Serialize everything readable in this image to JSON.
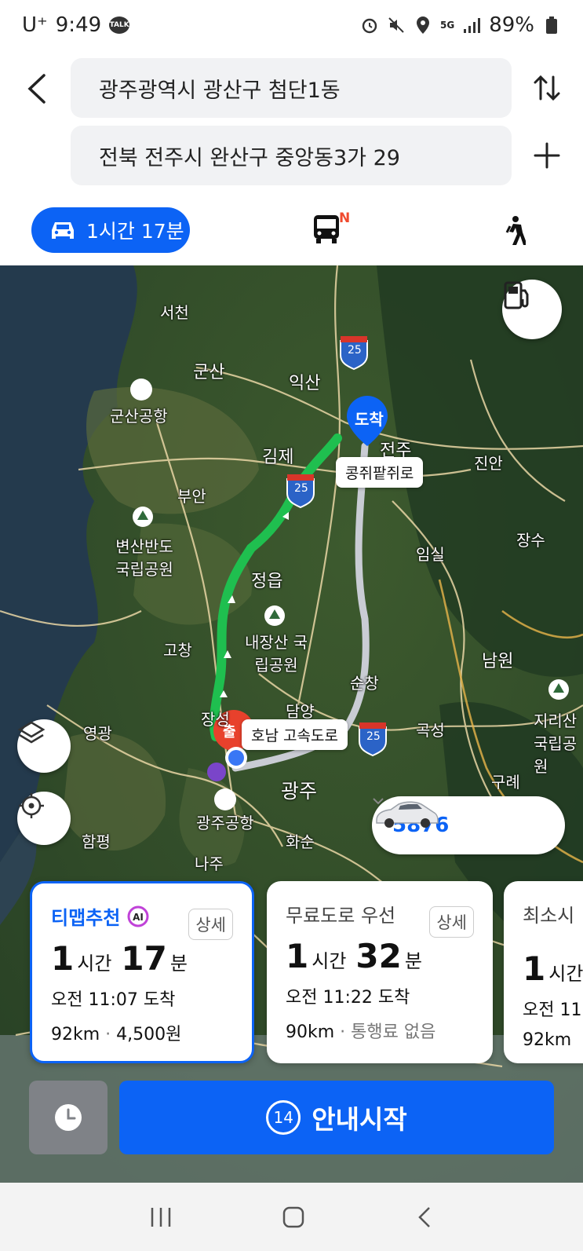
{
  "status_bar": {
    "carrier": "U⁺",
    "time": "9:49",
    "talk_badge": "TALK",
    "network": "5G",
    "battery": "89%"
  },
  "search": {
    "origin": "광주광역시 광산구 첨단1동",
    "destination": "전북 전주시 완산구 중앙동3가 29"
  },
  "modes": {
    "car_label": "1시간 17분",
    "bus_badge": "N"
  },
  "map": {
    "labels": [
      "서천",
      "군산",
      "익산",
      "군산공항",
      "김제",
      "전주",
      "부안",
      "변산반도 국립공원",
      "정읍",
      "임실",
      "장수",
      "진안",
      "내장산 국립공원",
      "고창",
      "순창",
      "남원",
      "지리산 국립공원",
      "영광",
      "담양",
      "장성",
      "곡성",
      "구례",
      "광주",
      "광주공항",
      "함평",
      "화순",
      "나주"
    ],
    "shields": [
      "25",
      "25",
      "25"
    ],
    "arrive_pin": "도착",
    "start_pin": "출",
    "road_tag_1": "콩쥐팥쥐로",
    "road_tag_2": "호남 고속도로",
    "vehicle_number": "5876"
  },
  "routes": [
    {
      "title": "티맵추천",
      "detail": "상세",
      "hours": "1",
      "h_unit": "시간",
      "mins": "17",
      "m_unit": "분",
      "arrival": "오전 11:07 도착",
      "distance": "92km",
      "toll": "4,500원"
    },
    {
      "title": "무료도로 우선",
      "detail": "상세",
      "hours": "1",
      "h_unit": "시간",
      "mins": "32",
      "m_unit": "분",
      "arrival": "오전 11:22 도착",
      "distance": "90km",
      "toll": "통행료 없음"
    },
    {
      "title": "최소시",
      "hours": "1",
      "h_unit": "시간",
      "arrival": "오전 11",
      "distance": "92km"
    }
  ],
  "actions": {
    "guide_count": "14",
    "start_label": "안내시작"
  },
  "colors": {
    "accent": "#0c63f5",
    "route_main": "#1fbf4f",
    "route_alt": "#c9ccd4",
    "start_pin": "#e8412c"
  }
}
